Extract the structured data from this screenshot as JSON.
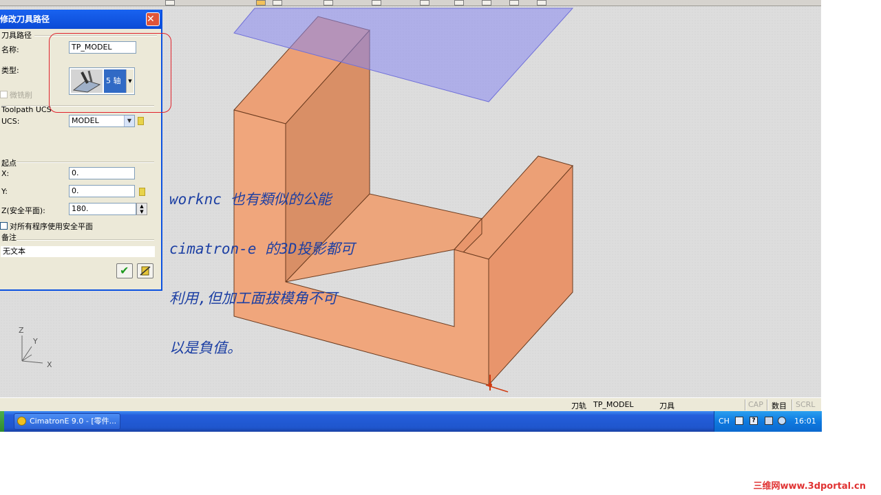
{
  "dialog": {
    "title": "修改刀具路径",
    "close_glyph": "✕",
    "section_toolpath": "刀具路径",
    "name_label": "名称:",
    "name_value": "TP_MODEL",
    "type_label": "类型:",
    "type_value": "5 轴",
    "micro_milling_label": "微铣削",
    "ucs_section": "Toolpath UCS",
    "ucs_label": "UCS:",
    "ucs_value": "MODEL",
    "start_section": "起点",
    "x_label": "X:",
    "x_value": "0.",
    "y_label": "Y:",
    "y_value": "0.",
    "z_label": "Z(安全平面):",
    "z_value": "180.",
    "all_programs_label": "对所有程序使用安全平面",
    "remark_section": "备注",
    "remark_value": "无文本",
    "ok_glyph": "✔"
  },
  "annotation": {
    "lines": [
      "worknc 也有類似的公能",
      "cimatron-e 的3D投影都可",
      "利用,但加工面拔模角不可",
      "以是負值。"
    ]
  },
  "axis": {
    "z": "Z",
    "y": "Y",
    "x": "X"
  },
  "statusbar": {
    "toolpath_label": "刀轨",
    "toolpath_value": "TP_MODEL",
    "tool_label": "刀具",
    "cap": "CAP",
    "num": "数目",
    "scrl": "SCRL"
  },
  "taskbar": {
    "task_label": "CimatronE 9.0 - [零件...",
    "tray_lang": "CH",
    "tray_help": "?",
    "clock": "16:01"
  },
  "watermark": "三维网www.3dportal.cn",
  "colors": {
    "part_face_front": "#f0a67c",
    "part_face_top": "#eca076",
    "part_face_side": "#e8956c",
    "projection_plane": "#8888f0",
    "annotation_text": "#1c3fa3",
    "selection_mark": "#e0202a"
  }
}
